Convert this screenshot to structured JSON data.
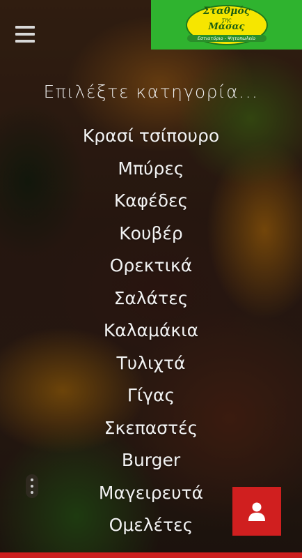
{
  "logo": {
    "title_line1": "Σταθμός",
    "title_small": "της",
    "title_line2": "Μάσας",
    "subtitle": "Εστιατόριο - Ψητοπωλείο"
  },
  "heading": "Επιλέξτε κατηγορία...",
  "categories": [
    "Κρασί τσίπουρο",
    "Μπύρες",
    "Καφέδες",
    "Κουβέρ",
    "Ορεκτικά",
    "Σαλάτες",
    "Καλαμάκια",
    "Τυλιχτά",
    "Γίγας",
    "Σκεπαστές",
    "Burger",
    "Μαγειρευτά",
    "Ομελέτες"
  ],
  "icons": {
    "menu": "hamburger-menu-icon",
    "user": "user-icon",
    "more": "vertical-dots-icon"
  },
  "colors": {
    "logo_bg": "#2fb32f",
    "logo_ellipse": "#f6e600",
    "accent_red": "#d01f1f",
    "text": "#f2f2f2"
  }
}
